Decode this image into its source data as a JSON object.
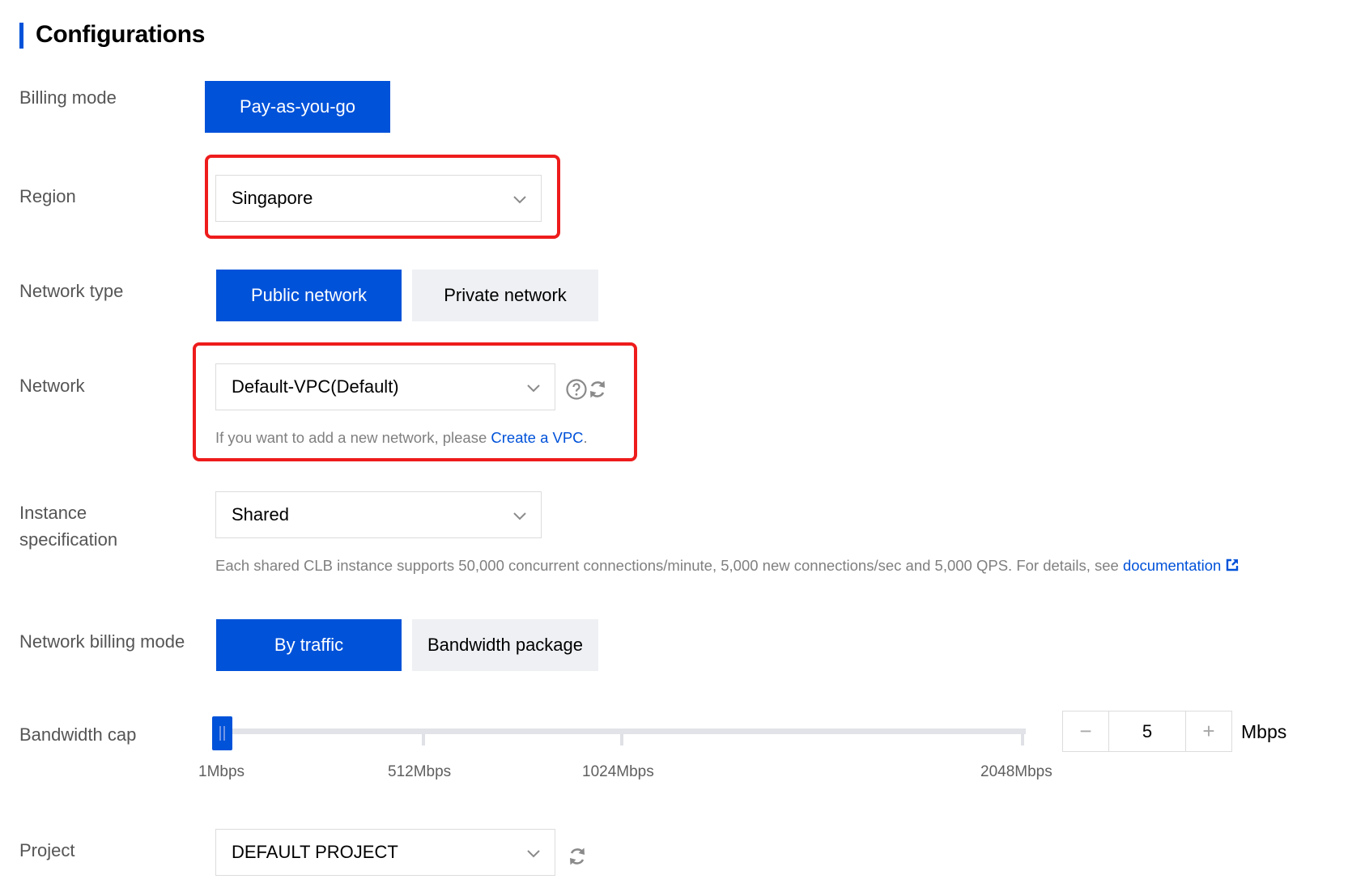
{
  "section": {
    "title": "Configurations"
  },
  "billing": {
    "label": "Billing mode",
    "option": "Pay-as-you-go"
  },
  "region": {
    "label": "Region",
    "value": "Singapore"
  },
  "network_type": {
    "label": "Network type",
    "options": [
      "Public network",
      "Private network"
    ],
    "selected": "Public network"
  },
  "network": {
    "label": "Network",
    "value": "Default-VPC(Default)",
    "helper_prefix": "If you want to add a new network, please ",
    "helper_link": "Create a VPC",
    "helper_suffix": "."
  },
  "instance_spec": {
    "label_line1": "Instance",
    "label_line2": "specification",
    "value": "Shared",
    "helper": "Each shared CLB instance supports 50,000 concurrent connections/minute, 5,000 new connections/sec and 5,000 QPS. For details, see ",
    "helper_link": "documentation"
  },
  "network_billing": {
    "label": "Network billing mode",
    "options": [
      "By traffic",
      "Bandwidth package"
    ],
    "selected": "By traffic"
  },
  "bandwidth": {
    "label": "Bandwidth cap",
    "tick_labels": [
      "1Mbps",
      "512Mbps",
      "1024Mbps",
      "2048Mbps"
    ],
    "min": 1,
    "max": 2048,
    "value": 5,
    "value_text": "5",
    "unit": "Mbps",
    "minus": "−",
    "plus": "+"
  },
  "project": {
    "label": "Project",
    "value": "DEFAULT PROJECT"
  },
  "colors": {
    "primary": "#0052d9",
    "highlight": "#ee1c1c",
    "secondary_bg": "#eef0f3"
  },
  "icons": [
    "chevron-down-icon",
    "help-circle-icon",
    "refresh-icon",
    "external-link-icon"
  ]
}
